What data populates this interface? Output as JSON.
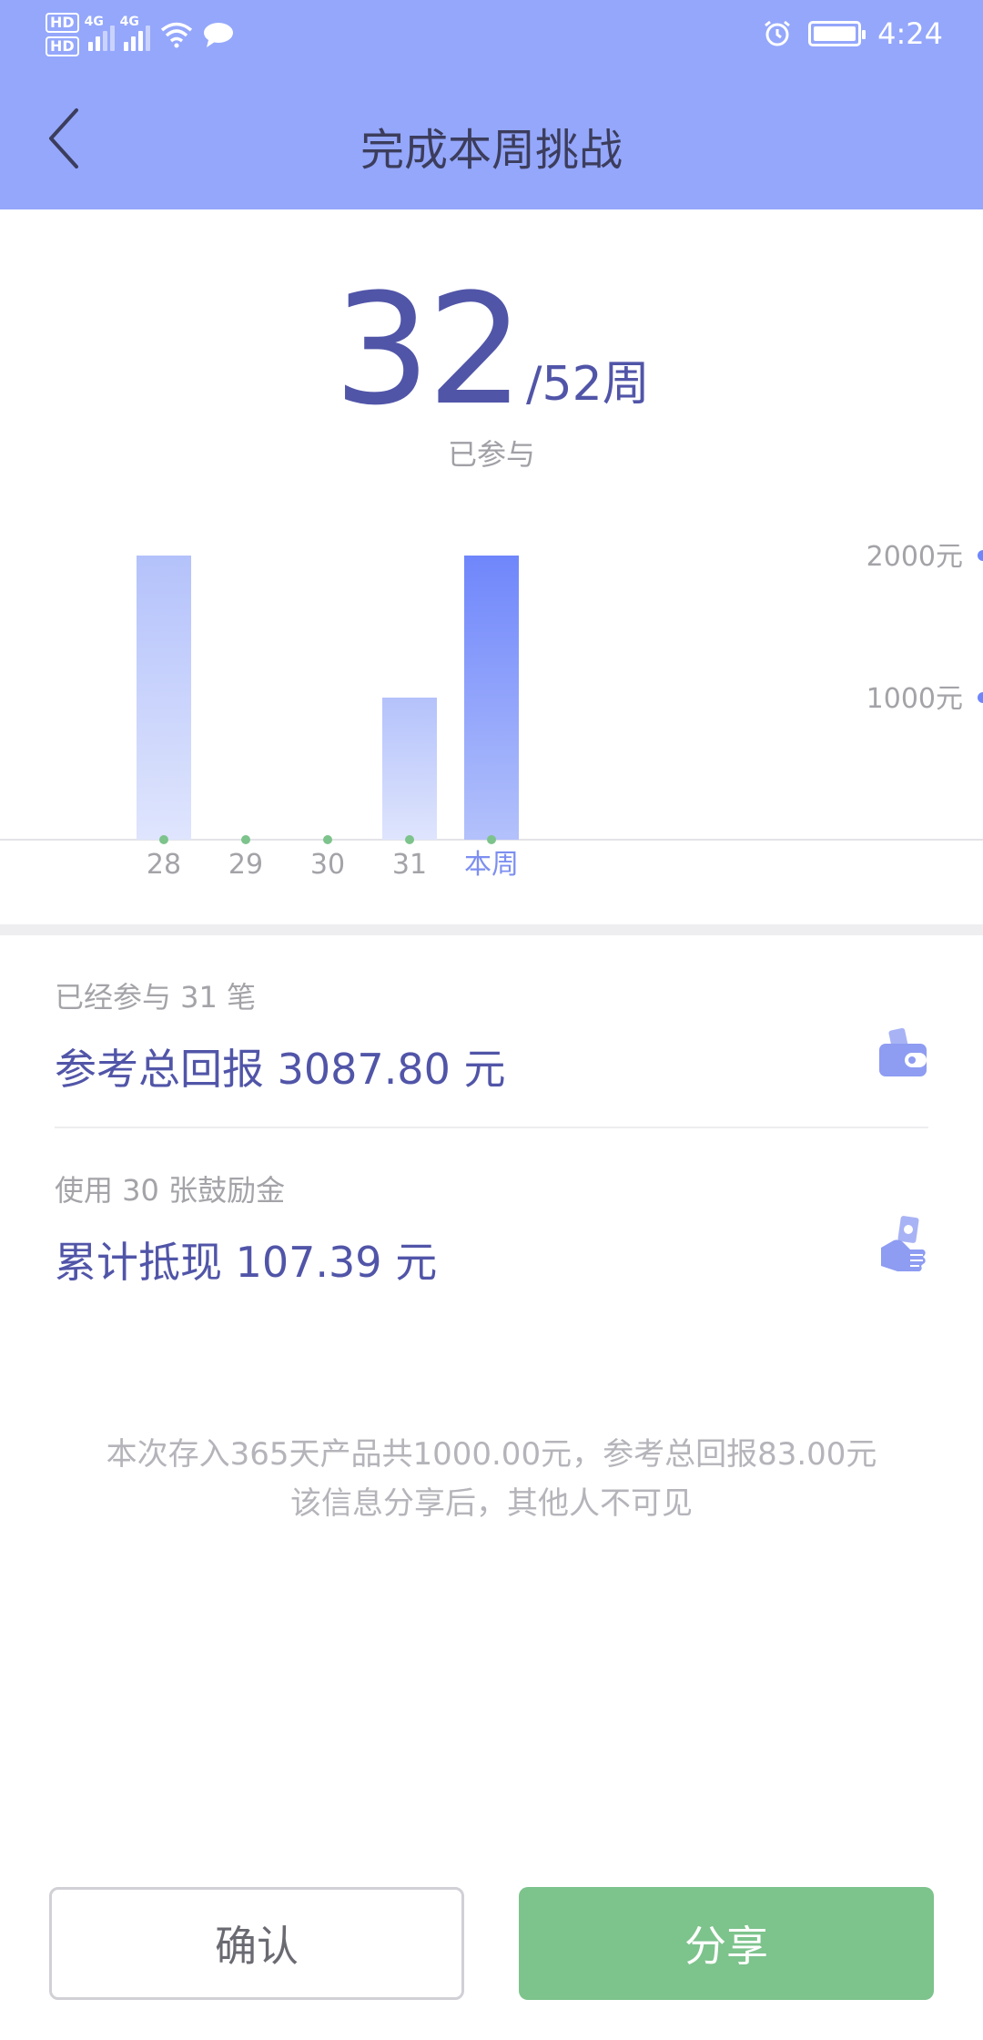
{
  "status_bar": {
    "hd1": "HD",
    "hd2": "HD",
    "net1": "4G",
    "net2": "4G",
    "time": "4:24"
  },
  "nav": {
    "title": "完成本周挑战",
    "back_icon": "chevron-left-icon"
  },
  "hero": {
    "count": "32",
    "total": "/52周",
    "caption": "已参与"
  },
  "chart_data": {
    "type": "bar",
    "categories": [
      "28",
      "29",
      "30",
      "31",
      "本周"
    ],
    "values": [
      2000,
      0,
      0,
      1000,
      2000
    ],
    "ylim": [
      0,
      2000
    ],
    "y_ticks": [
      {
        "value": 2000,
        "label": "2000元"
      },
      {
        "value": 1000,
        "label": "1000元"
      }
    ],
    "highlight_category": "本周",
    "colors": {
      "bar_top": "#b4c2fb",
      "bar_bottom": "#dfe5fd",
      "bar_highlight_top": "#6f86fb",
      "bar_highlight_bottom": "#b3c1fb",
      "dot": "#7dc38c",
      "axis_label": "#a3a3a8",
      "highlight_label": "#7d8ff0",
      "tick_dot": "#6f86fb"
    }
  },
  "stats": [
    {
      "label": "已经参与 31 笔",
      "value": "参考总回报 3087.80 元",
      "icon": "wallet-icon"
    },
    {
      "label": "使用 30 张鼓励金",
      "value": "累计抵现 107.39 元",
      "icon": "hand-money-icon"
    }
  ],
  "info": {
    "line1": "本次存入365天产品共1000.00元，参考总回报83.00元",
    "line2": "该信息分享后，其他人不可见"
  },
  "buttons": {
    "confirm": "确认",
    "share": "分享"
  },
  "colors": {
    "header": "#94a7fb",
    "accent": "#5155a8",
    "share": "#7dc38c"
  }
}
